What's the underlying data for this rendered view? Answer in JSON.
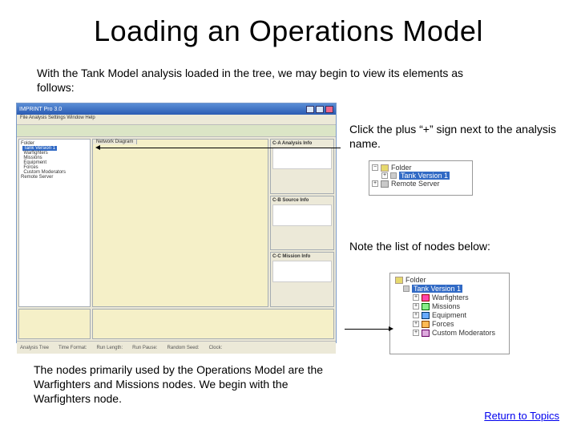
{
  "title": "Loading an Operations Model",
  "intro": "With the Tank Model analysis loaded in the tree, we may begin to view its elements as follows:",
  "callout1": "Click the plus “+” sign next to the analysis name.",
  "callout2": "Note the list of nodes below:",
  "bottom_text": "The nodes primarily used by the Operations Model are the Warfighters and Missions nodes.  We begin with the Warfighters node.",
  "return_link": "Return to Topics",
  "app": {
    "title": "IMPRINT Pro 3.0",
    "menubar": "File  Analysis  Settings  Window  Help",
    "tab": "Network Diagram",
    "tree": {
      "root_prefix": "Folder",
      "selected": "Tank Version 1",
      "nodes": [
        "Warfighters",
        "Missions",
        "Equipment",
        "Forces",
        "Custom Moderators"
      ],
      "remote": "Remote Server"
    },
    "right_panels": {
      "a": "C-A Analysis Info",
      "b": "C-B Source Info",
      "c": "C-C Mission Info"
    },
    "status": [
      "Analysis Tree",
      "Time Format:",
      "Run Length:",
      "Run Pause:",
      "Random Seed:",
      "Clock:"
    ]
  },
  "mini1": {
    "folder": "Folder",
    "selected": "Tank Version 1",
    "remote": "Remote Server"
  },
  "mini2": {
    "folder": "Folder",
    "selected": "Tank Version 1",
    "children": [
      "Warfighters",
      "Missions",
      "Equipment",
      "Forces",
      "Custom Moderators"
    ]
  },
  "chart_data": null
}
